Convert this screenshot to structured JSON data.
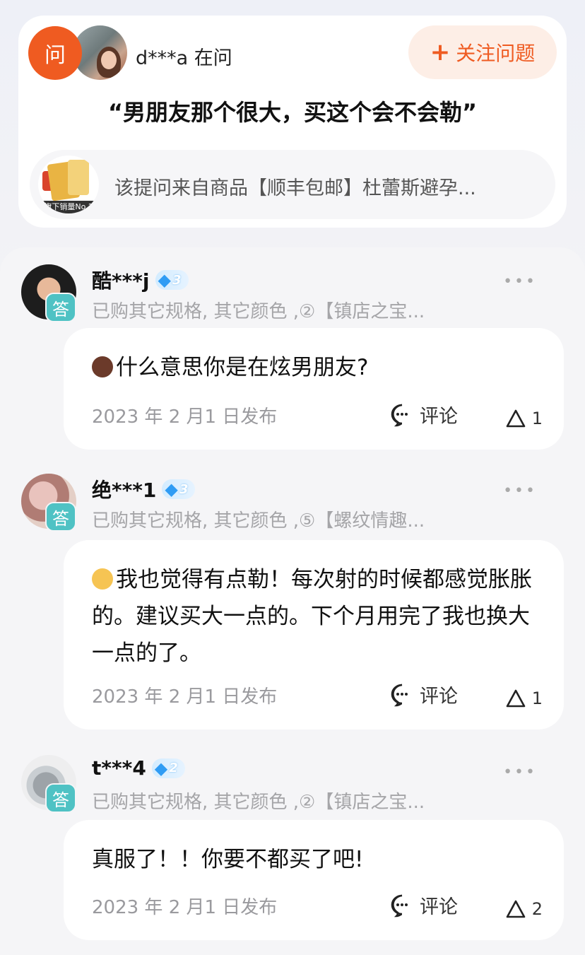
{
  "question": {
    "badge": "问",
    "asker": "d***a 在问",
    "follow_label": "关注问题",
    "follow_icon": "plus-icon",
    "text": "“男朋友那个很大，买这个会不会勒”",
    "product_text": "该提问来自商品【顺丰包邮】杜蕾斯避孕...",
    "product_strip": "旗下销量No.1"
  },
  "answers": [
    {
      "badge": "答",
      "name": "酷***j",
      "level": "3",
      "spec": "已购其它规格, 其它颜色 ,②【镇店之宝...",
      "emoji_color": "#6b3a2a",
      "text": "什么意思你是在炫男朋友?",
      "date": "2023 年 2 月1 日发布",
      "comment_label": "评论",
      "likes": "1"
    },
    {
      "badge": "答",
      "name": "绝***1",
      "level": "3",
      "spec": "已购其它规格, 其它颜色 ,⑤【螺纹情趣...",
      "emoji_color": "#f6c453",
      "text": "我也觉得有点勒！每次射的时候都感觉胀胀的。建议买大一点的。下个月用完了我也换大一点的了。",
      "date": "2023 年 2 月1 日发布",
      "comment_label": "评论",
      "likes": "1"
    },
    {
      "badge": "答",
      "name": "t***4",
      "level": "2",
      "spec": "已购其它规格, 其它颜色 ,②【镇店之宝...",
      "emoji_color": "",
      "text": "真服了！！你要不都买了吧!",
      "date": "2023 年 2 月1 日发布",
      "comment_label": "评论",
      "likes": "2"
    }
  ]
}
